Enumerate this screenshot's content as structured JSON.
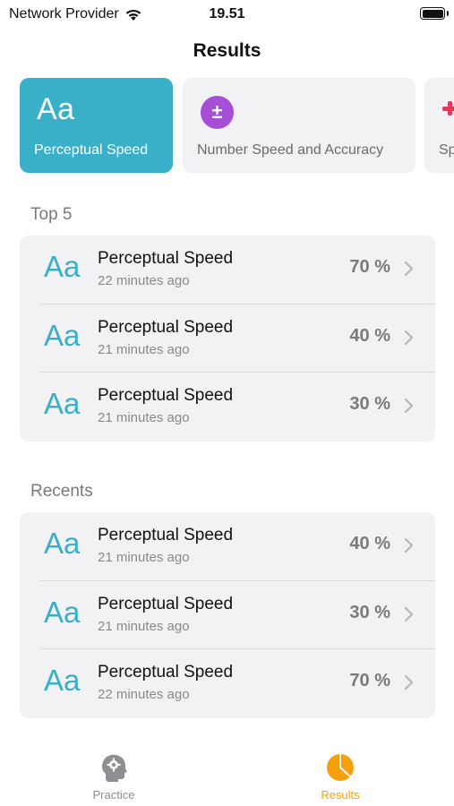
{
  "status_bar": {
    "carrier": "Network Provider",
    "time": "19.51"
  },
  "nav": {
    "title": "Results"
  },
  "categories": [
    {
      "label": "Perceptual Speed",
      "icon_text": "Aa",
      "active": true
    },
    {
      "label": "Number Speed and Accuracy",
      "icon_text": "±",
      "active": false
    },
    {
      "label": "Sp",
      "icon_text": "",
      "active": false
    }
  ],
  "top5": {
    "header": "Top 5",
    "rows": [
      {
        "icon_text": "Aa",
        "title": "Perceptual Speed",
        "time": "22 minutes ago",
        "score": "70 %"
      },
      {
        "icon_text": "Aa",
        "title": "Perceptual Speed",
        "time": "21 minutes ago",
        "score": "40 %"
      },
      {
        "icon_text": "Aa",
        "title": "Perceptual Speed",
        "time": "21 minutes ago",
        "score": "30 %"
      }
    ]
  },
  "recents": {
    "header": "Recents",
    "rows": [
      {
        "icon_text": "Aa",
        "title": "Perceptual Speed",
        "time": "21 minutes ago",
        "score": "40 %"
      },
      {
        "icon_text": "Aa",
        "title": "Perceptual Speed",
        "time": "21 minutes ago",
        "score": "30 %"
      },
      {
        "icon_text": "Aa",
        "title": "Perceptual Speed",
        "time": "22 minutes ago",
        "score": "70 %"
      }
    ]
  },
  "tabs": [
    {
      "label": "Practice",
      "icon": "brain-gear-icon",
      "active": false
    },
    {
      "label": "Results",
      "icon": "pie-chart-icon",
      "active": true
    }
  ],
  "colors": {
    "accent": "#39b0c8",
    "tab_active": "#f5a10c",
    "number_category": "#a54fd6",
    "third_category": "#e8365e"
  }
}
